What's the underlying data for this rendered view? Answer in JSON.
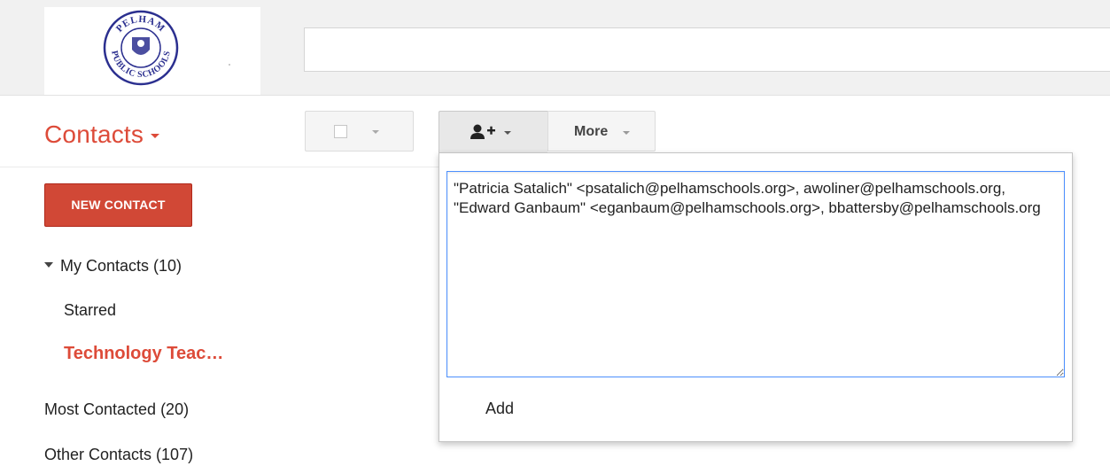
{
  "header": {
    "logo_top_text": "PELHAM",
    "logo_bottom_text": "PUBLIC SCHOOLS",
    "search": {
      "value": "",
      "placeholder": ""
    }
  },
  "app": {
    "title": "Contacts"
  },
  "toolbar": {
    "select_icon": "checkbox-icon",
    "add_icon": "person-add-icon",
    "more_label": "More"
  },
  "sidebar": {
    "new_contact_label": "NEW CONTACT",
    "group": {
      "label": "My Contacts (10)"
    },
    "items": [
      {
        "label": "Starred"
      },
      {
        "label": "Technology Teac…",
        "active": true
      },
      {
        "label": "Most Contacted (20)"
      },
      {
        "label": "Other Contacts (107)"
      }
    ]
  },
  "popup": {
    "textarea_value": "\"Patricia Satalich\" <psatalich@pelhamschools.org>, awoliner@pelhamschools.org, \"Edward Ganbaum\" <eganbaum@pelhamschools.org>, bbattersby@pelhamschools.org",
    "add_label": "Add"
  },
  "colors": {
    "accent": "#dd4b39",
    "button_red": "#d14836",
    "focus_blue": "#4d90fe",
    "logo_blue": "#2b2f8f"
  }
}
